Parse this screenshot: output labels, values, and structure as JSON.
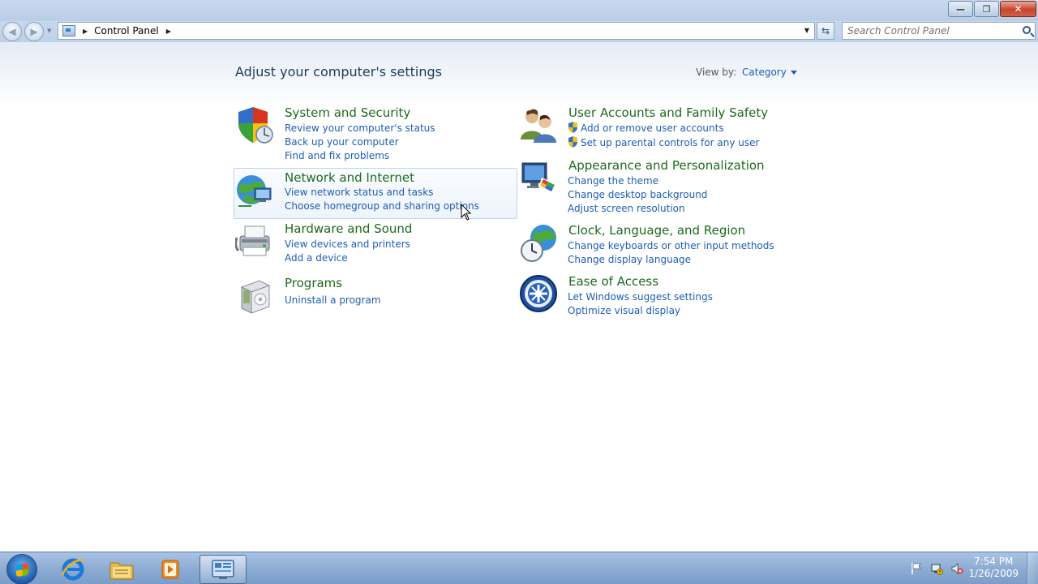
{
  "window": {
    "caption_buttons": {
      "minimize": "—",
      "maximize": "❐",
      "close": "✕"
    }
  },
  "nav": {
    "back_icon": "back-arrow-icon",
    "forward_icon": "forward-arrow-icon",
    "address": "Control Panel",
    "search_placeholder": "Search Control Panel"
  },
  "main": {
    "heading": "Adjust your computer's settings",
    "view_by_label": "View by:",
    "view_by_value": "Category",
    "categories_left": [
      {
        "title": "System and Security",
        "icon": "shield-icon",
        "links": [
          "Review your computer's status",
          "Back up your computer",
          "Find and fix problems"
        ]
      },
      {
        "title": "Network and Internet",
        "icon": "network-globe-icon",
        "links": [
          "View network status and tasks",
          "Choose homegroup and sharing options"
        ]
      },
      {
        "title": "Hardware and Sound",
        "icon": "printer-icon",
        "links": [
          "View devices and printers",
          "Add a device"
        ]
      },
      {
        "title": "Programs",
        "icon": "programs-box-icon",
        "links": [
          "Uninstall a program"
        ]
      }
    ],
    "categories_right": [
      {
        "title": "User Accounts and Family Safety",
        "icon": "users-icon",
        "links": [
          "Add or remove user accounts",
          "Set up parental controls for any user"
        ]
      },
      {
        "title": "Appearance and Personalization",
        "icon": "monitor-palette-icon",
        "links": [
          "Change the theme",
          "Change desktop background",
          "Adjust screen resolution"
        ]
      },
      {
        "title": "Clock, Language, and Region",
        "icon": "clock-globe-icon",
        "links": [
          "Change keyboards or other input methods",
          "Change display language"
        ]
      },
      {
        "title": "Ease of Access",
        "icon": "ease-of-access-icon",
        "links": [
          "Let Windows suggest settings",
          "Optimize visual display"
        ]
      }
    ]
  },
  "taskbar": {
    "items": [
      "start-orb-icon",
      "internet-explorer-icon",
      "windows-explorer-icon",
      "media-player-icon",
      "control-panel-icon"
    ],
    "clock_time": "7:54 PM",
    "clock_date": "1/26/2009"
  },
  "colors": {
    "category_title": "#1c6a1c",
    "link": "#1e5db5",
    "heading": "#1e395b"
  }
}
